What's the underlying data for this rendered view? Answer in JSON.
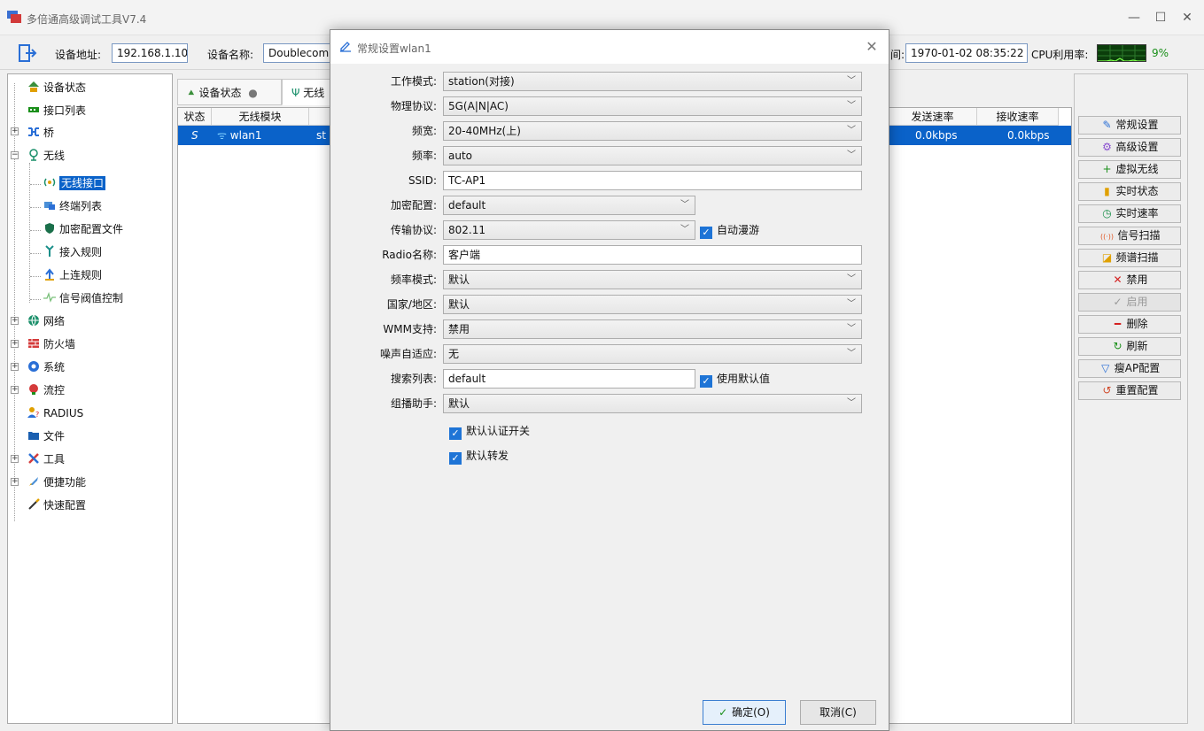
{
  "window": {
    "title": "多倍通高级调试工具V7.4",
    "minimize": "—",
    "maximize": "☐",
    "close": "✕"
  },
  "toolbar": {
    "device_addr_label": "设备地址:",
    "device_addr_value": "192.168.1.10",
    "device_name_label": "设备名称:",
    "device_name_value": "Doublecom",
    "time_label_partial": "间:",
    "time_value": "1970-01-02 08:35:22",
    "cpu_label": "CPU利用率:",
    "cpu_percent": "9%",
    "cpu_level": 0.09
  },
  "tree": {
    "items": [
      {
        "label": "设备状态",
        "icon": "device-status-icon"
      },
      {
        "label": "接口列表",
        "icon": "interface-list-icon"
      },
      {
        "label": "桥",
        "icon": "bridge-icon"
      },
      {
        "label": "无线",
        "icon": "wireless-icon"
      },
      {
        "label": "无线接口",
        "icon": "wireless-interface-icon"
      },
      {
        "label": "终端列表",
        "icon": "terminal-list-icon"
      },
      {
        "label": "加密配置文件",
        "icon": "shield-icon"
      },
      {
        "label": "接入规则",
        "icon": "access-rule-icon"
      },
      {
        "label": "上连规则",
        "icon": "uplink-rule-icon"
      },
      {
        "label": "信号阀值控制",
        "icon": "signal-threshold-icon"
      },
      {
        "label": "网络",
        "icon": "globe-icon"
      },
      {
        "label": "防火墙",
        "icon": "firewall-icon"
      },
      {
        "label": "系统",
        "icon": "system-icon"
      },
      {
        "label": "流控",
        "icon": "flow-control-icon"
      },
      {
        "label": "RADIUS",
        "icon": "radius-icon"
      },
      {
        "label": "文件",
        "icon": "folder-icon"
      },
      {
        "label": "工具",
        "icon": "tools-icon"
      },
      {
        "label": "便捷功能",
        "icon": "rocket-icon"
      },
      {
        "label": "快速配置",
        "icon": "wand-icon"
      }
    ]
  },
  "tabs": [
    {
      "label": "设备状态"
    },
    {
      "label": "无线"
    }
  ],
  "grid": {
    "headers": [
      "状态",
      "无线模块",
      "发送速率",
      "接收速率"
    ],
    "row": {
      "status": "S",
      "module": "wlan1",
      "mode_partial": "st",
      "tx_rate": "0.0kbps",
      "rx_rate": "0.0kbps"
    }
  },
  "rightbuttons": [
    {
      "label": "常规设置",
      "icon": "✎",
      "color": "#2a6fd6"
    },
    {
      "label": "高级设置",
      "icon": "⚙",
      "color": "#8a4fd0"
    },
    {
      "label": "虚拟无线",
      "icon": "+",
      "color": "#1a8f1a"
    },
    {
      "label": "实时状态",
      "icon": "▮",
      "color": "#e0a000"
    },
    {
      "label": "实时速率",
      "icon": "◷",
      "color": "#1a8f4a"
    },
    {
      "label": "信号扫描",
      "icon": "((·))",
      "color": "#e05a2a"
    },
    {
      "label": "频谱扫描",
      "icon": "◪",
      "color": "#e0a000"
    },
    {
      "label": "禁用",
      "icon": "✕",
      "color": "#d42020"
    },
    {
      "label": "启用",
      "icon": "✓",
      "color": "#9a9a9a"
    },
    {
      "label": "删除",
      "icon": "━",
      "color": "#d42020"
    },
    {
      "label": "刷新",
      "icon": "↻",
      "color": "#1a8f1a"
    },
    {
      "label": "瘦AP配置",
      "icon": "▽",
      "color": "#2a6fd6"
    },
    {
      "label": "重置配置",
      "icon": "↺",
      "color": "#d04a2a"
    }
  ],
  "dialog": {
    "title": "常规设置wlan1",
    "close": "✕",
    "fields": {
      "work_mode": {
        "label": "工作模式:",
        "value": "station(对接)"
      },
      "phy_protocol": {
        "label": "物理协议:",
        "value": "5G(A|N|AC)"
      },
      "bandwidth": {
        "label": "频宽:",
        "value": "20-40MHz(上)"
      },
      "frequency": {
        "label": "频率:",
        "value": "auto"
      },
      "ssid": {
        "label": "SSID:",
        "value": "TC-AP1"
      },
      "encryption": {
        "label": "加密配置:",
        "value": "default"
      },
      "transport": {
        "label": "传输协议:",
        "value": "802.11"
      },
      "auto_roam": {
        "label": "自动漫游",
        "checked": true
      },
      "radio_name": {
        "label": "Radio名称:",
        "value": "客户端"
      },
      "freq_mode": {
        "label": "频率模式:",
        "value": "默认"
      },
      "country": {
        "label": "国家/地区:",
        "value": "默认"
      },
      "wmm": {
        "label": "WMM支持:",
        "value": "禁用"
      },
      "noise_adapt": {
        "label": "噪声自适应:",
        "value": "无"
      },
      "scan_list": {
        "label": "搜索列表:",
        "value": "default"
      },
      "use_default": {
        "label": "使用默认值",
        "checked": true
      },
      "multicast": {
        "label": "组播助手:",
        "value": "默认"
      },
      "default_auth": {
        "label": "默认认证开关",
        "checked": true
      },
      "default_forward": {
        "label": "默认转发",
        "checked": true
      }
    },
    "ok_label": "确定(O)",
    "cancel_label": "取消(C)"
  }
}
